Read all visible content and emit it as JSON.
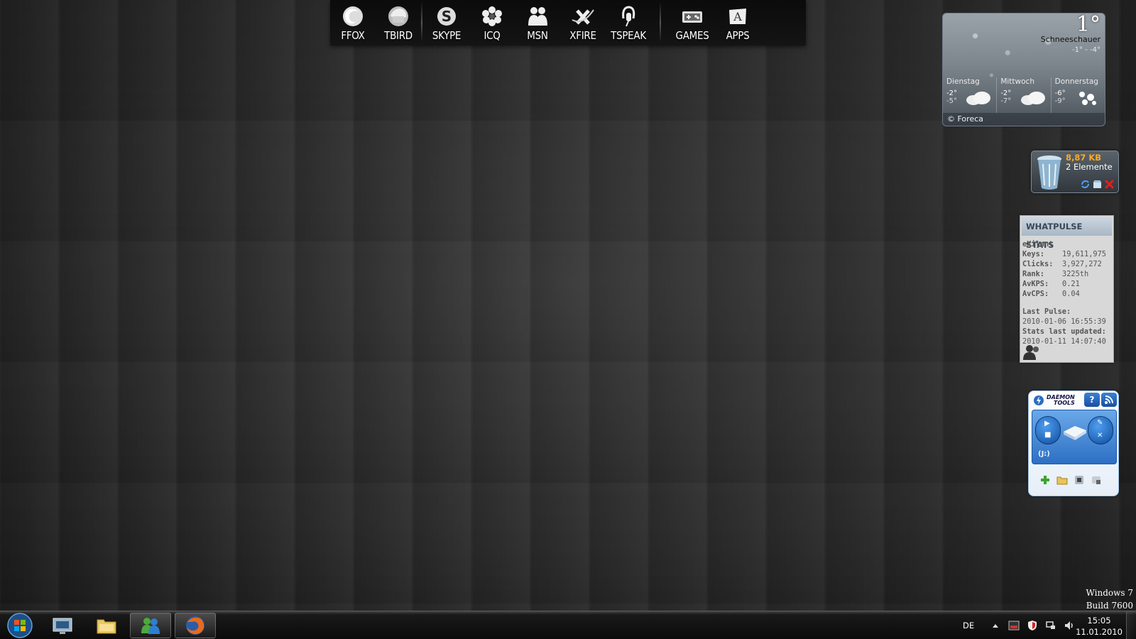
{
  "dock": {
    "groups": [
      [
        {
          "label": "FFOX",
          "icon": "firefox-icon"
        },
        {
          "label": "TBIRD",
          "icon": "thunderbird-icon"
        }
      ],
      [
        {
          "label": "SKYPE",
          "icon": "skype-icon"
        },
        {
          "label": "ICQ",
          "icon": "icq-flower-icon"
        },
        {
          "label": "MSN",
          "icon": "msn-buddies-icon"
        },
        {
          "label": "XFIRE",
          "icon": "xfire-icon"
        },
        {
          "label": "TSPEAK",
          "icon": "teamspeak-headset-icon"
        }
      ],
      [
        {
          "label": "GAMES",
          "icon": "gamepad-icon"
        },
        {
          "label": "APPS",
          "icon": "apps-icon"
        }
      ]
    ]
  },
  "weather": {
    "temp": "1°",
    "condition": "Schneeschauer",
    "range": "-1° - -4°",
    "days": [
      {
        "name": "Dienstag",
        "hi": "-2°",
        "lo": "-5°",
        "icon": "cloudy-icon"
      },
      {
        "name": "Mittwoch",
        "hi": "-2°",
        "lo": "-7°",
        "icon": "cloudy-icon"
      },
      {
        "name": "Donnerstag",
        "hi": "-6°",
        "lo": "-9°",
        "icon": "snow-icon"
      }
    ],
    "credit": "© Foreca"
  },
  "recycle": {
    "size": "8,87 KB",
    "count": "2 Elemente",
    "actions": [
      "refresh-icon",
      "open-bin-icon",
      "empty-bin-icon"
    ]
  },
  "whatpulse": {
    "title": "WHATPULSE STATS",
    "user": "eXilant",
    "stats": [
      {
        "k": "Keys:",
        "v": "19,611,975"
      },
      {
        "k": "Clicks:",
        "v": "3,927,272"
      },
      {
        "k": "Rank:",
        "v": "3225th"
      },
      {
        "k": "AvKPS:",
        "v": "0.21"
      },
      {
        "k": "AvCPS:",
        "v": "0.04"
      }
    ],
    "last_pulse_label": "Last Pulse:",
    "last_pulse": "2010-01-06 16:55:39",
    "updated_label": "Stats last updated:",
    "updated": "2010-01-11 14:07:40"
  },
  "daemon": {
    "logo_line1": "DAEMON",
    "logo_line2": "TOOLS",
    "help": "?",
    "drive_label": "(J:)"
  },
  "watermark": {
    "line1": "Windows 7",
    "line2": "Build 7600"
  },
  "taskbar": {
    "pinned": [
      "media-center-icon",
      "explorer-folder-icon",
      "messenger-icon",
      "firefox-icon"
    ],
    "language": "DE",
    "tray": [
      "tray-expand-icon",
      "hfs-icon",
      "security-shield-icon",
      "network-icon",
      "volume-icon"
    ],
    "time": "15:05",
    "date": "11.01.2010"
  }
}
